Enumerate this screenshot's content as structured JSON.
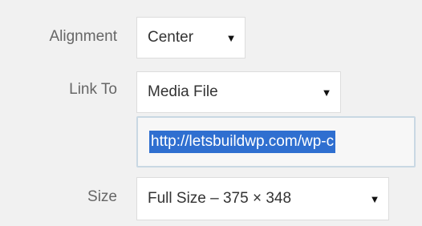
{
  "attachment_display_settings": {
    "alignment": {
      "label": "Alignment",
      "value": "Center",
      "arrow_icon": "triangle-down"
    },
    "link_to": {
      "label": "Link To",
      "value": "Media File",
      "arrow_icon": "triangle-down"
    },
    "link_url": {
      "value": "http://letsbuildwp.com/wp-c",
      "selected": true
    },
    "size": {
      "label": "Size",
      "value": "Full Size – 375 × 348",
      "arrow_icon": "triangle-down"
    },
    "colors": {
      "background": "#f1f1f1",
      "selection": "#2f6fd0",
      "focus_border": "#c9d8e3"
    }
  }
}
